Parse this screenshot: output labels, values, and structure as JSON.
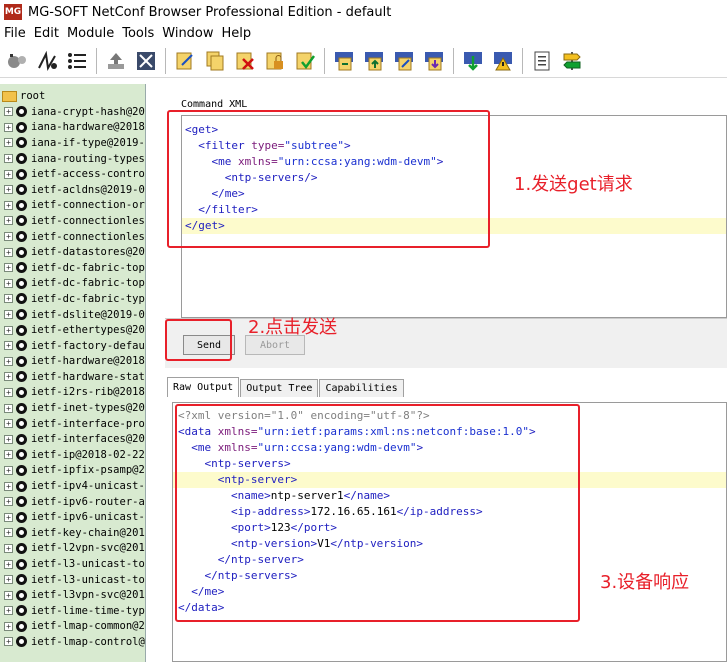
{
  "window": {
    "logo": "MG",
    "title": "MG-SOFT NetConf Browser Professional Edition - default"
  },
  "menu": [
    "File",
    "Edit",
    "Module",
    "Tools",
    "Window",
    "Help"
  ],
  "toolbar_icons": [
    "connect-icon",
    "network-icon",
    "list-icon",
    "upload-icon",
    "disconnect-icon",
    "edit-icon",
    "copy-icon",
    "delete-icon",
    "lock-icon",
    "check-icon",
    "doc-arrow-icon",
    "doc-up-icon",
    "doc-edit-icon",
    "doc-down-icon",
    "download-icon",
    "warning-icon",
    "notes-icon",
    "signpost-icon"
  ],
  "tree": {
    "root": "root",
    "modules": [
      "iana-crypt-hash@20",
      "iana-hardware@2018",
      "iana-if-type@2019-",
      "iana-routing-types",
      "ietf-access-contro",
      "ietf-acldns@2019-0",
      "ietf-connection-or",
      "ietf-connectionles",
      "ietf-connectionles",
      "ietf-datastores@20",
      "ietf-dc-fabric-top",
      "ietf-dc-fabric-top",
      "ietf-dc-fabric-typ",
      "ietf-dslite@2019-0",
      "ietf-ethertypes@20",
      "ietf-factory-defau",
      "ietf-hardware@2018",
      "ietf-hardware-stat",
      "ietf-i2rs-rib@2018",
      "ietf-inet-types@20",
      "ietf-interface-pro",
      "ietf-interfaces@20",
      "ietf-ip@2018-02-22",
      "ietf-ipfix-psamp@2",
      "ietf-ipv4-unicast-",
      "ietf-ipv6-router-a",
      "ietf-ipv6-unicast-",
      "ietf-key-chain@201",
      "ietf-l2vpn-svc@201",
      "ietf-l3-unicast-to",
      "ietf-l3-unicast-to",
      "ietf-l3vpn-svc@201",
      "ietf-lime-time-typ",
      "ietf-lmap-common@2",
      "ietf-lmap-control@"
    ]
  },
  "command": {
    "label": "Command XML",
    "lines": [
      {
        "indent": "",
        "parts": [
          [
            "tag",
            "<get>"
          ]
        ]
      },
      {
        "indent": "  ",
        "parts": [
          [
            "tag",
            "<filter "
          ],
          [
            "attr",
            "type="
          ],
          [
            "val",
            "\"subtree\""
          ],
          [
            "tag",
            ">"
          ]
        ]
      },
      {
        "indent": "    ",
        "parts": [
          [
            "tag",
            "<me "
          ],
          [
            "attr",
            "xmlns="
          ],
          [
            "val",
            "\"urn:ccsa:yang:wdm-devm\""
          ],
          [
            "tag",
            ">"
          ]
        ]
      },
      {
        "indent": "      ",
        "parts": [
          [
            "tag",
            "<ntp-servers/>"
          ]
        ]
      },
      {
        "indent": "    ",
        "parts": [
          [
            "tag",
            "</me>"
          ]
        ]
      },
      {
        "indent": "  ",
        "parts": [
          [
            "tag",
            "</filter>"
          ]
        ]
      },
      {
        "indent": "",
        "parts": [
          [
            "tag",
            "</get>"
          ]
        ]
      }
    ],
    "highlight_line": 6
  },
  "buttons": {
    "send": "Send",
    "abort": "Abort"
  },
  "tabs": [
    "Raw Output",
    "Output Tree",
    "Capabilities"
  ],
  "output": {
    "lines": [
      {
        "indent": "",
        "parts": [
          [
            "decl",
            "<?xml version=\"1.0\" encoding=\"utf-8\"?>"
          ]
        ]
      },
      {
        "indent": "",
        "parts": [
          [
            "tag",
            "<data "
          ],
          [
            "attr",
            "xmlns="
          ],
          [
            "val",
            "\"urn:ietf:params:xml:ns:netconf:base:1.0\""
          ],
          [
            "tag",
            ">"
          ]
        ]
      },
      {
        "indent": "  ",
        "parts": [
          [
            "tag",
            "<me "
          ],
          [
            "attr",
            "xmlns="
          ],
          [
            "val",
            "\"urn:ccsa:yang:wdm-devm\""
          ],
          [
            "tag",
            ">"
          ]
        ]
      },
      {
        "indent": "    ",
        "parts": [
          [
            "tag",
            "<ntp-servers>"
          ]
        ]
      },
      {
        "indent": "      ",
        "parts": [
          [
            "tag",
            "<ntp-server>"
          ]
        ]
      },
      {
        "indent": "        ",
        "parts": [
          [
            "tag",
            "<name>"
          ],
          [
            "text",
            "ntp-server1"
          ],
          [
            "tag",
            "</name>"
          ]
        ]
      },
      {
        "indent": "        ",
        "parts": [
          [
            "tag",
            "<ip-address>"
          ],
          [
            "text",
            "172.16.65.161"
          ],
          [
            "tag",
            "</ip-address>"
          ]
        ]
      },
      {
        "indent": "        ",
        "parts": [
          [
            "tag",
            "<port>"
          ],
          [
            "text",
            "123"
          ],
          [
            "tag",
            "</port>"
          ]
        ]
      },
      {
        "indent": "        ",
        "parts": [
          [
            "tag",
            "<ntp-version>"
          ],
          [
            "text",
            "V1"
          ],
          [
            "tag",
            "</ntp-version>"
          ]
        ]
      },
      {
        "indent": "      ",
        "parts": [
          [
            "tag",
            "</ntp-server>"
          ]
        ]
      },
      {
        "indent": "    ",
        "parts": [
          [
            "tag",
            "</ntp-servers>"
          ]
        ]
      },
      {
        "indent": "  ",
        "parts": [
          [
            "tag",
            "</me>"
          ]
        ]
      },
      {
        "indent": "",
        "parts": [
          [
            "tag",
            "</data>"
          ]
        ]
      }
    ],
    "highlight_line": 4
  },
  "annotations": {
    "step1": "1.发送get请求",
    "step2": "2.点击发送",
    "step3": "3.设备响应"
  },
  "colors": {
    "annotation": "#e8202a",
    "tree_bg": "#d8ead0",
    "highlight": "#fdfbcc",
    "xml_tag": "#2020c0"
  }
}
